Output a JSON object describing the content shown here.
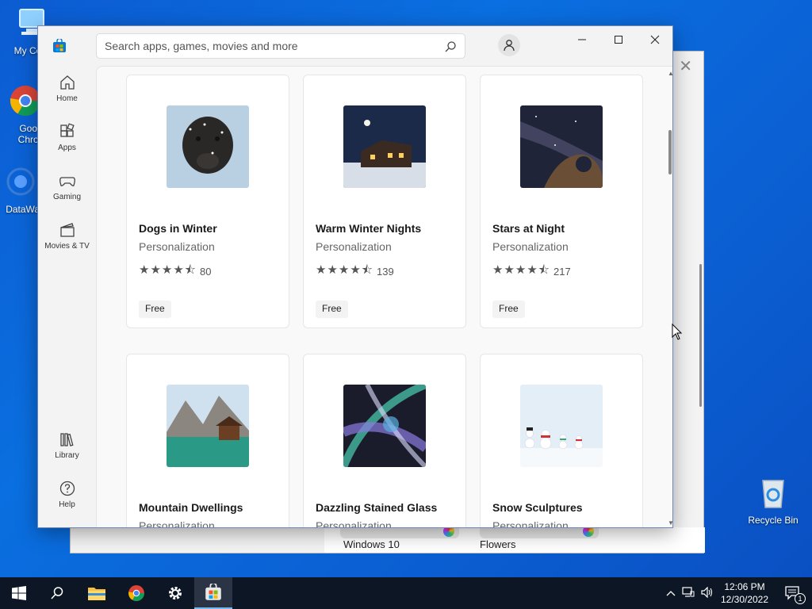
{
  "desktop": {
    "icons": [
      {
        "label": "My Com",
        "icon": "computer-icon"
      },
      {
        "label": "Goog Chron",
        "icon": "chrome-icon"
      },
      {
        "label": "DataWag",
        "icon": "datawag-icon"
      },
      {
        "label": "Recycle Bin",
        "icon": "recycle-bin-icon"
      }
    ]
  },
  "background_window": {
    "tiles": [
      {
        "label": "Windows 10"
      },
      {
        "label": "Flowers"
      }
    ]
  },
  "store": {
    "search": {
      "placeholder": "Search apps, games, movies and more"
    },
    "nav": [
      {
        "label": "Home",
        "icon": "home-icon"
      },
      {
        "label": "Apps",
        "icon": "apps-icon"
      },
      {
        "label": "Gaming",
        "icon": "gaming-icon"
      },
      {
        "label": "Movies & TV",
        "icon": "movies-tv-icon"
      },
      {
        "label": "Library",
        "icon": "library-icon"
      },
      {
        "label": "Help",
        "icon": "help-icon"
      }
    ],
    "cards": [
      {
        "title": "Dogs in Winter",
        "category": "Personalization",
        "rating_count": "80",
        "price": "Free",
        "stars": 4.5
      },
      {
        "title": "Warm Winter Nights",
        "category": "Personalization",
        "rating_count": "139",
        "price": "Free",
        "stars": 4.5
      },
      {
        "title": "Stars at Night",
        "category": "Personalization",
        "rating_count": "217",
        "price": "Free",
        "stars": 4.5
      },
      {
        "title": "Mountain Dwellings",
        "category": "Personalization"
      },
      {
        "title": "Dazzling Stained Glass",
        "category": "Personalization"
      },
      {
        "title": "Snow Sculptures",
        "category": "Personalization"
      }
    ]
  },
  "taskbar": {
    "time": "12:06 PM",
    "date": "12/30/2022",
    "notification_count": "1"
  },
  "colors": {
    "desktop_blue": "#0a6fe0",
    "taskbar": "#0d1624",
    "accent": "#76b9ed"
  }
}
